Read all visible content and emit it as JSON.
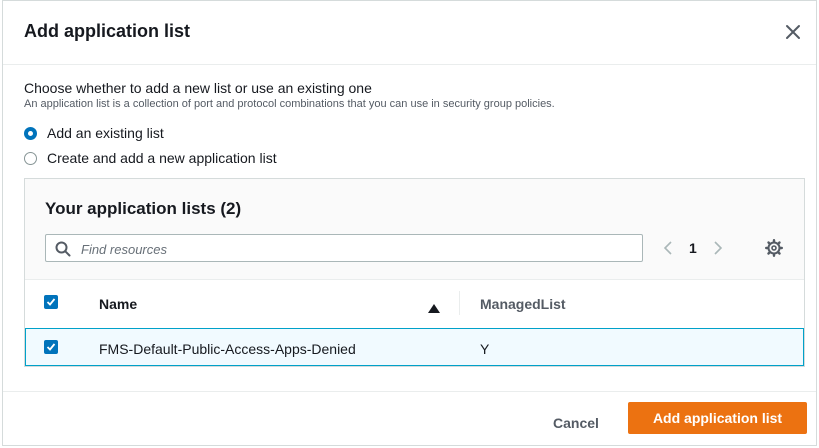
{
  "modal": {
    "title": "Add application list",
    "question": "Choose whether to add a new list or use an existing one",
    "description": "An application list is a collection of port and protocol combinations that you can use in security group policies.",
    "options": [
      {
        "label": "Add an existing list",
        "selected": true
      },
      {
        "label": "Create and add a new application list",
        "selected": false
      }
    ]
  },
  "panel": {
    "title": "Your application lists (2)",
    "search_placeholder": "Find resources",
    "page": "1",
    "columns": {
      "name": "Name",
      "managed": "ManagedList"
    },
    "rows": [
      {
        "name": "FMS-Default-Public-Access-Apps-Denied",
        "managed": "Y",
        "checked": true
      }
    ]
  },
  "footer": {
    "cancel": "Cancel",
    "primary": "Add application list"
  },
  "colors": {
    "accent": "#0073bb",
    "primary_button": "#ec7211"
  }
}
